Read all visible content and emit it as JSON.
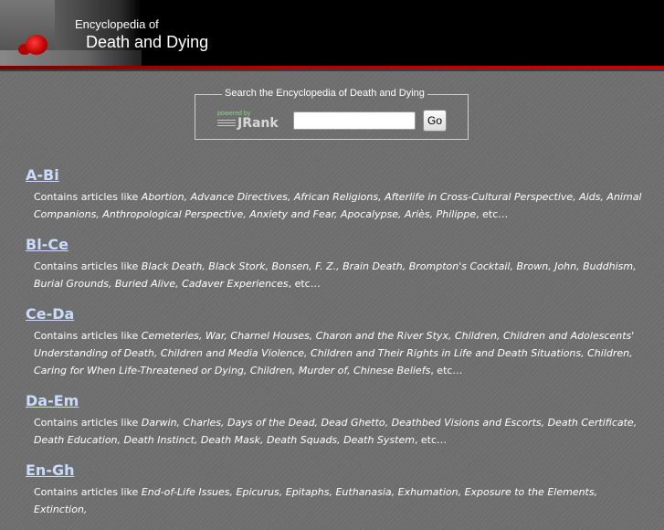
{
  "header": {
    "title_small": "Encyclopedia of",
    "title_large": "Death and Dying"
  },
  "search": {
    "legend": "Search the Encyclopedia of Death and Dying",
    "powered_by": "powered by",
    "brand": "JRank",
    "input_value": "",
    "go_label": "Go"
  },
  "sections": [
    {
      "label": "A-Bi",
      "prefix": "Contains articles like ",
      "topics": "Abortion, Advance Directives, African Religions, Afterlife in Cross-Cultural Perspective, Aids, Animal Companions, Anthropological Perspective, Anxiety and Fear, Apocalypse, Ariès, Philippe",
      "suffix": ", etc…"
    },
    {
      "label": "Bl-Ce",
      "prefix": "Contains articles like ",
      "topics": "Black Death, Black Stork, Bonsen, F. Z., Brain Death, Brompton's Cocktail, Brown, John, Buddhism, Burial Grounds, Buried Alive, Cadaver Experiences",
      "suffix": ", etc…"
    },
    {
      "label": "Ce-Da",
      "prefix": "Contains articles like ",
      "topics": "Cemeteries, War, Charnel Houses, Charon and the River Styx, Children, Children and Adolescents' Understanding of Death, Children and Media Violence, Children and Their Rights in Life and Death Situations, Children, Caring for When Life-Threatened or Dying, Children, Murder of, Chinese Beliefs",
      "suffix": ", etc…"
    },
    {
      "label": "Da-Em",
      "prefix": "Contains articles like ",
      "topics": "Darwin, Charles, Days of the Dead, Dead Ghetto, Deathbed Visions and Escorts, Death Certificate, Death Education, Death Instinct, Death Mask, Death Squads, Death System",
      "suffix": ", etc…"
    },
    {
      "label": "En-Gh",
      "prefix": "Contains articles like ",
      "topics": "End-of-Life Issues, Epicurus, Epitaphs, Euthanasia, Exhumation, Exposure to the Elements, Extinction,",
      "suffix": ""
    }
  ]
}
